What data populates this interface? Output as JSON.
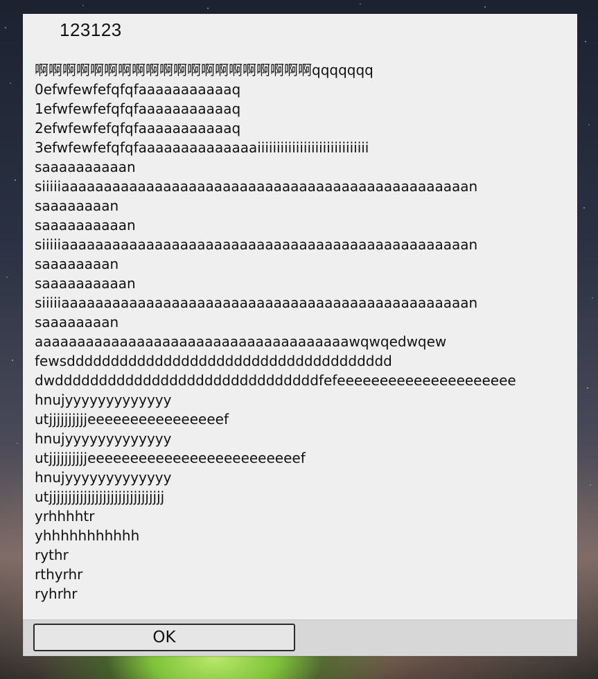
{
  "dialog": {
    "title": "123123",
    "message_lines": [
      "啊啊啊啊啊啊啊啊啊啊啊啊啊啊啊啊啊啊啊啊qqqqqqq",
      "0efwfewfefqfqfaaaaaaaaaaaq",
      "1efwfewfefqfqfaaaaaaaaaaaq",
      "2efwfewfefqfqfaaaaaaaaaaaq",
      "3efwfewfefqfqfaaaaaaaaaaaaaaiiiiiiiiiiiiiiiiiiiiiiiiiiiii",
      "saaaaaaaaaan",
      "siiiiiaaaaaaaaaaaaaaaaaaaaaaaaaaaaaaaaaaaaaaaaaaaaaaaan",
      "saaaaaaaan",
      "saaaaaaaaaan",
      "siiiiiaaaaaaaaaaaaaaaaaaaaaaaaaaaaaaaaaaaaaaaaaaaaaaaan",
      "saaaaaaaan",
      "saaaaaaaaaan",
      "siiiiiaaaaaaaaaaaaaaaaaaaaaaaaaaaaaaaaaaaaaaaaaaaaaaaan",
      "saaaaaaaan",
      "aaaaaaaaaaaaaaaaaaaaaaaaaaaaaaaaaaaaawqwqedwqew",
      "fewsddddddddddddddddddddddddddddddddddddd",
      "dwddddddddddddddddddddddddddddddfefeeeeeeeeeeeeeeeeeeeee",
      "hnujyyyyyyyyyyyyy",
      "utjjjjjjjjjjeeeeeeeeeeeeeeeef",
      "hnujyyyyyyyyyyyyy",
      "utjjjjjjjjjjeeeeeeeeeeeeeeeeeeeeeeeeef",
      "hnujyyyyyyyyyyyyy",
      "utjjjjjjjjjjjjjjjjjjjjjjjjjjjjjj",
      "yrhhhhtr",
      "yhhhhhhhhhhh",
      "rythr",
      "rthyrhr",
      "ryhrhr"
    ],
    "ok_label": "OK"
  }
}
